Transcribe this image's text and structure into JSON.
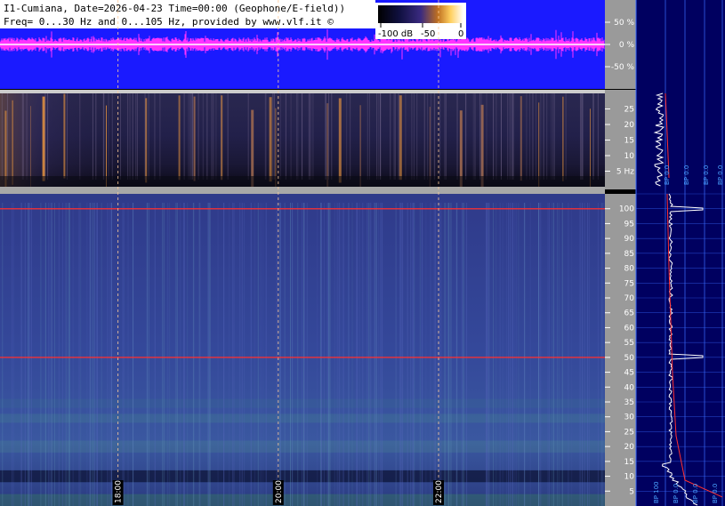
{
  "header": {
    "line1": "I1-Cumiana, Date=2026-04-23 Time=00:00 (Geophone/E-field))",
    "line2": "Freq= 0...30 Hz and 0...105 Hz, provided by www.vlf.it ©"
  },
  "colorbar": {
    "labels": [
      "-100 dB",
      "-50",
      "0"
    ]
  },
  "chart_data": [
    {
      "type": "area",
      "name": "amplitude-trace",
      "ytick_labels": [
        "50 %",
        "0 %",
        "-50 %"
      ],
      "yticks": [
        50,
        0,
        -50
      ],
      "ylim": [
        -100,
        100
      ]
    },
    {
      "type": "heatmap",
      "name": "low-frequency-spectrogram",
      "ylim": [
        0,
        30
      ],
      "yticks": [
        5,
        10,
        15,
        20,
        25
      ],
      "ytick_labels": [
        "5 Hz",
        "10",
        "15",
        "20",
        "25"
      ],
      "hot_columns_fraction": [
        0.008,
        0.02,
        0.05,
        0.07,
        0.105,
        0.175,
        0.24,
        0.295,
        0.32,
        0.365,
        0.415,
        0.445,
        0.455,
        0.54,
        0.56,
        0.595,
        0.66,
        0.71,
        0.76,
        0.795,
        0.86,
        0.89,
        0.93,
        0.975
      ]
    },
    {
      "type": "heatmap",
      "name": "high-frequency-spectrogram",
      "ylim": [
        0,
        105
      ],
      "yticks": [
        5,
        10,
        15,
        20,
        25,
        30,
        35,
        40,
        45,
        50,
        55,
        60,
        65,
        70,
        75,
        80,
        85,
        90,
        95,
        100
      ],
      "ytick_labels": [
        "5",
        "10",
        "15",
        "20",
        "25",
        "30",
        "35",
        "40",
        "45",
        "50",
        "55",
        "60",
        "65",
        "70",
        "75",
        "80",
        "85",
        "90",
        "95",
        "100"
      ],
      "lines_hz": [
        50,
        100
      ],
      "time_markers": [
        {
          "label": "18:00",
          "fraction": 0.195
        },
        {
          "label": "20:00",
          "fraction": 0.46
        },
        {
          "label": "22:00",
          "fraction": 0.725
        }
      ]
    },
    {
      "type": "line",
      "name": "side-spectrum",
      "bp_labels_bottom": [
        "BP 100",
        "BP 0.0",
        "BP 0.0",
        "BP 0.0",
        "BP 0.0"
      ],
      "bp_labels_top": [
        "BP 0.0",
        "BP 0.0",
        "BP 0.0",
        "BP 0.0"
      ]
    }
  ]
}
